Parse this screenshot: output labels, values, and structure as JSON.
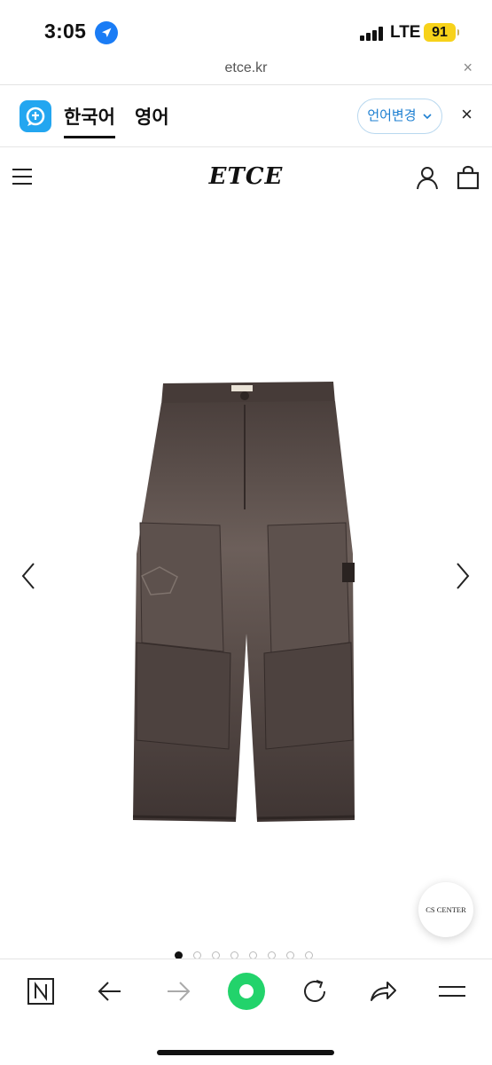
{
  "status": {
    "time": "3:05",
    "network": "LTE",
    "battery": "91"
  },
  "browser": {
    "url": "etce.kr",
    "close_icon": "×"
  },
  "translate": {
    "active_language": "한국어",
    "other_language": "영어",
    "change_button": "언어변경",
    "close_icon": "×"
  },
  "site": {
    "logo": "ETCE"
  },
  "product": {
    "image_description": "brown cargo pants",
    "carousel_total": 8,
    "carousel_active_index": 0,
    "cs_button": "CS CENTER"
  },
  "colors": {
    "accent_blue": "#1a7cf5",
    "papago_blue": "#23a6f0",
    "battery_yellow": "#f7d21a",
    "green_home": "#22d36b",
    "pants_brown": "#4e4340"
  },
  "toolbar": {
    "icons": [
      "n-icon",
      "back-arrow-icon",
      "forward-arrow-icon",
      "home-circle-icon",
      "refresh-icon",
      "share-icon",
      "menu-icon"
    ]
  }
}
